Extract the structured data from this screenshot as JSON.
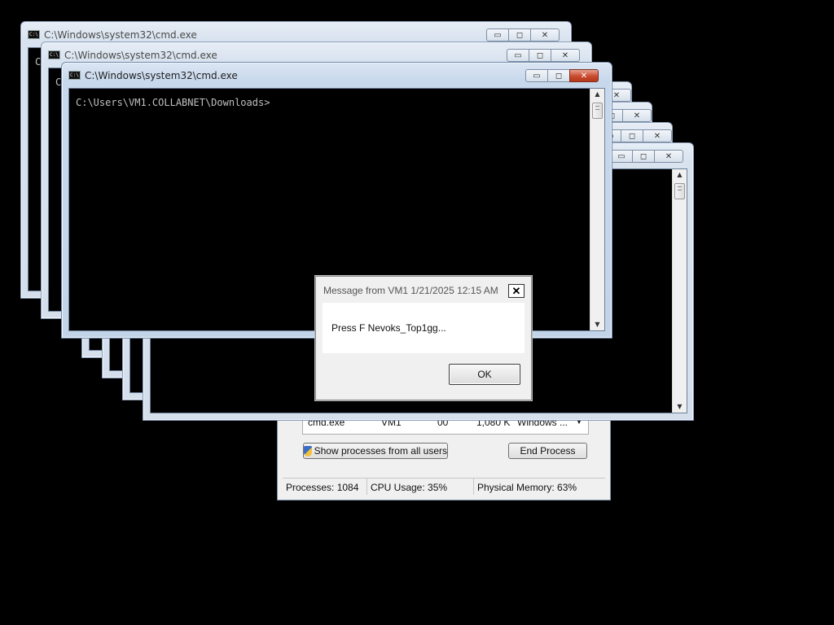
{
  "windows": {
    "title": "C:\\Windows\\system32\\cmd.exe",
    "prompt": "C:\\Users\\VM1.COLLABNET\\Downloads>",
    "partial_prompt": "C:",
    "minimize_glyph": "▭",
    "maximize_glyph": "◻",
    "close_glyph": "✕"
  },
  "taskmgr": {
    "row": {
      "image_name": "cmd.exe",
      "user": "VM1",
      "cpu": "00",
      "memory": "1,080 K",
      "description": "Windows ..."
    },
    "show_all_button": "Show processes from all users",
    "end_process_button": "End Process",
    "status": {
      "processes": "Processes: 1084",
      "cpu": "CPU Usage: 35%",
      "memory": "Physical Memory: 63%"
    }
  },
  "message_box": {
    "title": "Message from VM1 1/21/2025 12:15 AM",
    "text": "Press F Nevoks_Top1gg...",
    "ok_button": "OK",
    "close_glyph": "✕"
  },
  "colors": {
    "desktop": "#000000",
    "console_text": "#c0c0c0",
    "close_button_active": "#c94b2e",
    "frame": "#c3d4e8"
  },
  "icons": [
    "cmd-icon",
    "minimize-icon",
    "maximize-icon",
    "close-icon",
    "shield-icon",
    "scroll-up-icon",
    "scroll-down-icon"
  ]
}
